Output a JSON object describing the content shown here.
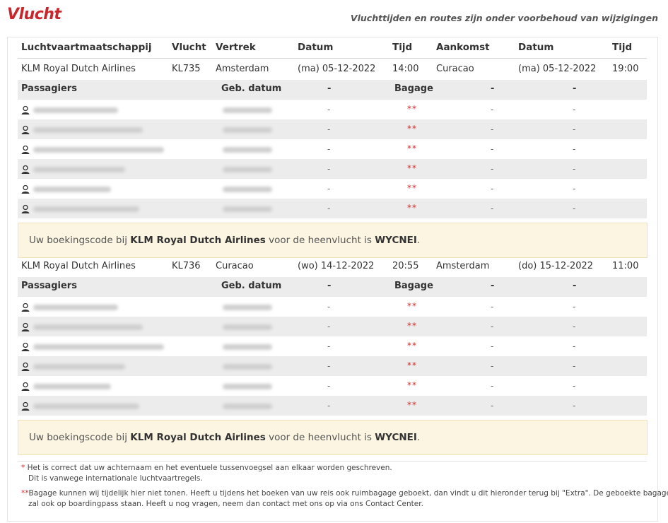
{
  "title": "Vlucht",
  "subtitle": "Vluchttijden en routes zijn onder voorbehoud van wijzigingen",
  "columns": [
    "Luchtvaartmaatschappij",
    "Vlucht",
    "Vertrek",
    "Datum",
    "Tijd",
    "Aankomst",
    "Datum",
    "Tijd"
  ],
  "passenger_header": {
    "passagiers": "Passagiers",
    "geb_datum": "Geb. datum",
    "dash": "-",
    "bagage": "Bagage"
  },
  "flights": [
    {
      "airline": "KLM Royal Dutch Airlines",
      "flight": "KL735",
      "departure": "Amsterdam",
      "dep_date": "(ma) 05-12-2022",
      "dep_time": "14:00",
      "arrival": "Curacao",
      "arr_date": "(ma) 05-12-2022",
      "arr_time": "19:00",
      "passengers": [
        {
          "dash": "-",
          "baggage": "**"
        },
        {
          "dash": "-",
          "baggage": "**"
        },
        {
          "dash": "-",
          "baggage": "**"
        },
        {
          "dash": "-",
          "baggage": "**"
        },
        {
          "dash": "-",
          "baggage": "**"
        },
        {
          "dash": "-",
          "baggage": "**"
        }
      ],
      "notice": {
        "prefix": "Uw boekingscode bij",
        "airline": "KLM Royal Dutch Airlines",
        "middle": "voor de heenvlucht is",
        "code": "WYCNEI",
        "suffix": "."
      }
    },
    {
      "airline": "KLM Royal Dutch Airlines",
      "flight": "KL736",
      "departure": "Curacao",
      "dep_date": "(wo) 14-12-2022",
      "dep_time": "20:55",
      "arrival": "Amsterdam",
      "arr_date": "(do) 15-12-2022",
      "arr_time": "11:00",
      "passengers": [
        {
          "dash": "-",
          "baggage": "**"
        },
        {
          "dash": "-",
          "baggage": "**"
        },
        {
          "dash": "-",
          "baggage": "**"
        },
        {
          "dash": "-",
          "baggage": "**"
        },
        {
          "dash": "-",
          "baggage": "**"
        },
        {
          "dash": "-",
          "baggage": "**"
        }
      ],
      "notice": {
        "prefix": "Uw boekingscode bij",
        "airline": "KLM Royal Dutch Airlines",
        "middle": "voor de heenvlucht is",
        "code": "WYCNEI",
        "suffix": "."
      }
    }
  ],
  "footnotes": {
    "note1_mark": "*",
    "note1_line1": "Het is correct dat uw achternaam en het eventuele tussenvoegsel aan elkaar worden geschreven.",
    "note1_line2": "Dit is vanwege internationale luchtvaartregels.",
    "note2_mark": "**",
    "note2_line1": "Bagage kunnen wij tijdelijk hier niet tonen. Heeft u tijdens het boeken van uw reis ook ruimbagage geboekt, dan vindt u dit hieronder terug bij \"Extra\". De geboekte bagage",
    "note2_line2": "zal ook op boardingpass staan. Heeft u nog vragen, neem dan contact met ons op via ons Contact Center."
  },
  "icons": {
    "passenger": "person-icon"
  },
  "colors": {
    "title": "#c9262c",
    "stars": "#d12b2b",
    "notice_bg": "#fbf5e2"
  }
}
